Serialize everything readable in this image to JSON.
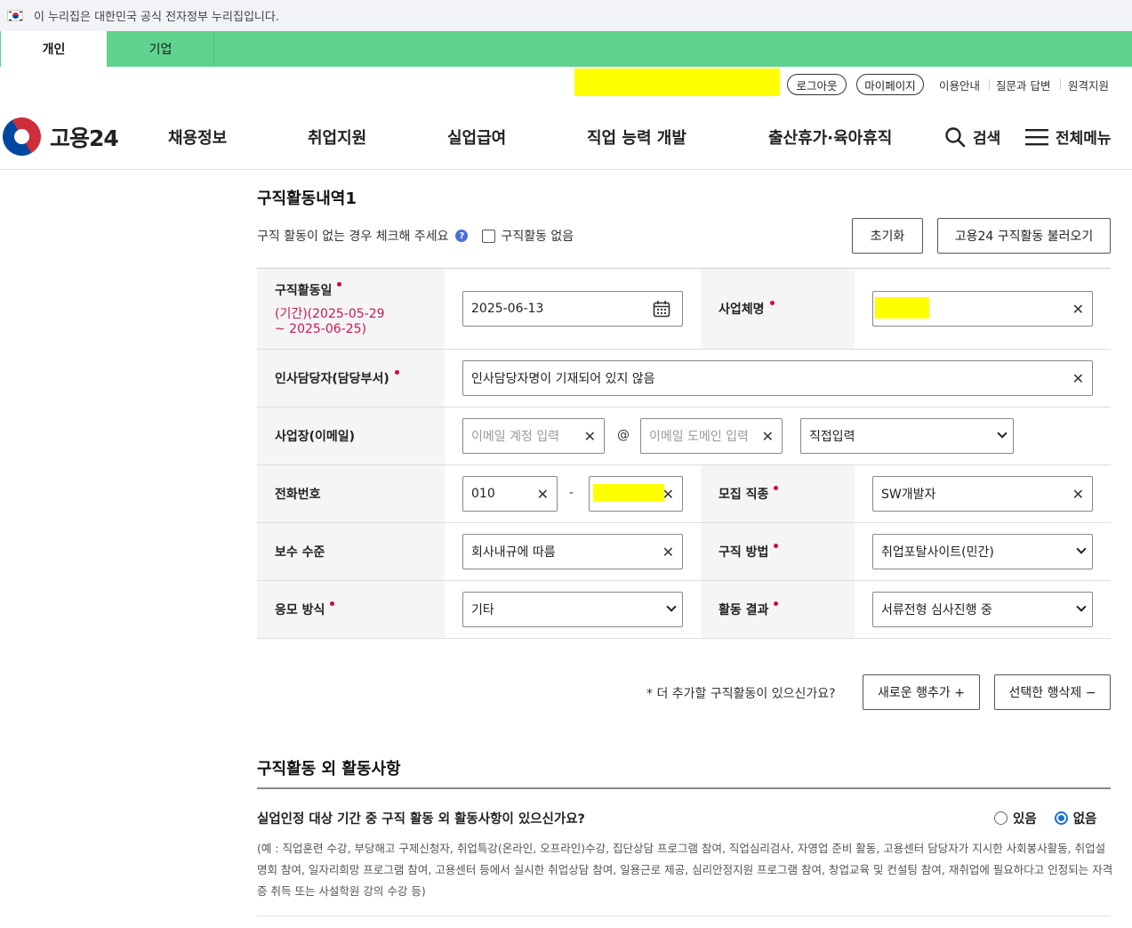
{
  "gov_banner": {
    "text": "이 누리집은 대한민국 공식 전자정부 누리집입니다."
  },
  "user_tabs": [
    {
      "label": "개인",
      "active": true
    },
    {
      "label": "기업",
      "active": false
    }
  ],
  "util": {
    "logout": "로그아웃",
    "mypage": "마이페이지",
    "guide": "이용안내",
    "qna": "질문과 답변",
    "remote": "원격지원"
  },
  "logo": {
    "text": "고용24"
  },
  "nav": [
    "채용정보",
    "취업지원",
    "실업급여",
    "직업 능력 개발",
    "출산휴가·육아휴직"
  ],
  "nav_right": {
    "search": "검색",
    "menu": "전체메뉴"
  },
  "section1": {
    "title": "구직활동내역1",
    "no_activity_hint": "구직 활동이 없는 경우 체크해 주세요",
    "no_activity_checkbox": "구직활동 없음",
    "reset_button": "초기화",
    "import_button": "고용24 구직활동 불러오기",
    "fields": {
      "date_label": "구직활동일",
      "date_period_1": "(기간)(2025-05-29",
      "date_period_2": "~ 2025-06-25)",
      "date_value": "2025-06-13",
      "company_label": "사업체명",
      "hr_label": "인사담당자(담당부서)",
      "hr_value": "인사담당자명이 기재되어 있지 않음",
      "email_label": "사업장(이메일)",
      "email_account_placeholder": "이메일 계정 입력",
      "email_at": "@",
      "email_domain_placeholder": "이메일 도메인 입력",
      "email_domain_select": "직접입력",
      "phone_label": "전화번호",
      "phone_prefix": "010",
      "phone_dash": "-",
      "job_label": "모집 직종",
      "job_value": "SW개발자",
      "salary_label": "보수 수준",
      "salary_value": "회사내규에 따름",
      "method_label": "구직 방법",
      "method_value": "취업포탈사이트(민간)",
      "apply_label": "응모 방식",
      "apply_value": "기타",
      "result_label": "활동 결과",
      "result_value": "서류전형 심사진행 중"
    },
    "add_question": "* 더 추가할 구직활동이 있으신가요?",
    "add_row_button": "새로운 행추가 +",
    "delete_row_button": "선택한 행삭제 −"
  },
  "section2": {
    "title": "구직활동 외 활동사항",
    "question": "실업인정 대상 기간 중 구직 활동 외 활동사항이 있으신가요?",
    "yes": "있음",
    "no": "없음",
    "selected": "없음",
    "example": "(예 : 직업훈련 수강, 부당해고 구제신청자, 취업특강(온라인, 오프라인)수강, 집단상담 프로그램 참여, 직업심리검사, 자영업 준비 활동, 고용센터 담당자가 지시한 사회봉사활동, 취업설명회 참여, 일자리희망 프로그램 참여, 고용센터 등에서 실시한 취업상담 참여, 일용근로 제공, 심리안정지원 프로그램 참여, 창업교육 및 컨설팅 참여, 재취업에 필요하다고 인정되는 자격증 취득 또는 사설학원 강의 수강 등)"
  },
  "colors": {
    "green": "#5fd38d",
    "required": "#d6004c",
    "accent": "#1a6ed8",
    "period": "#c8185a"
  }
}
